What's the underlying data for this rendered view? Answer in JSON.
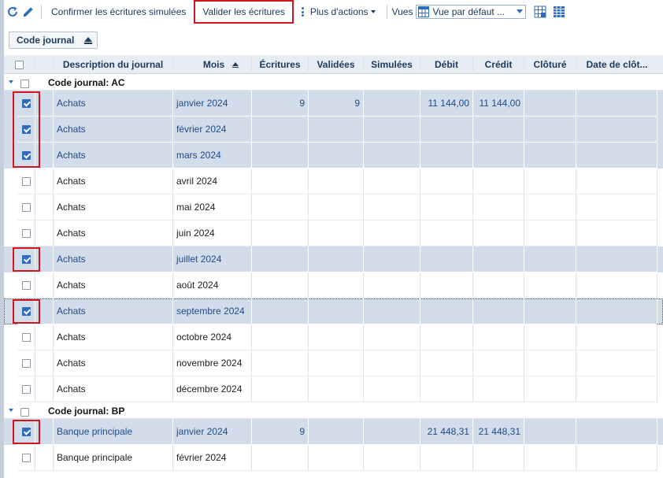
{
  "toolbar": {
    "refresh_icon": "refresh-icon",
    "edit_icon": "pencil-icon",
    "confirm_label": "Confirmer les écritures simulées",
    "validate_label": "Valider les écritures",
    "more_label": "Plus d'actions",
    "views_label": "Vues",
    "view_select_value": "Vue par défaut ..."
  },
  "grouping": {
    "label": "Code journal"
  },
  "columns": {
    "description": "Description du journal",
    "month": "Mois",
    "entries": "Écritures",
    "validated": "Validées",
    "simulated": "Simulées",
    "debit": "Débit",
    "credit": "Crédit",
    "closed": "Clôturé",
    "close_date": "Date de clôt..."
  },
  "groups": [
    {
      "title": "Code journal: AC",
      "rows": [
        {
          "desc": "Achats",
          "month": "janvier 2024",
          "entries": "9",
          "validated": "9",
          "simulated": "",
          "debit": "11 144,00",
          "credit": "11 144,00",
          "closed": "",
          "close_date": "",
          "checked": true
        },
        {
          "desc": "Achats",
          "month": "février 2024",
          "entries": "",
          "validated": "",
          "simulated": "",
          "debit": "",
          "credit": "",
          "closed": "",
          "close_date": "",
          "checked": true
        },
        {
          "desc": "Achats",
          "month": "mars 2024",
          "entries": "",
          "validated": "",
          "simulated": "",
          "debit": "",
          "credit": "",
          "closed": "",
          "close_date": "",
          "checked": true
        },
        {
          "desc": "Achats",
          "month": "avril 2024",
          "entries": "",
          "validated": "",
          "simulated": "",
          "debit": "",
          "credit": "",
          "closed": "",
          "close_date": "",
          "checked": false
        },
        {
          "desc": "Achats",
          "month": "mai 2024",
          "entries": "",
          "validated": "",
          "simulated": "",
          "debit": "",
          "credit": "",
          "closed": "",
          "close_date": "",
          "checked": false
        },
        {
          "desc": "Achats",
          "month": "juin 2024",
          "entries": "",
          "validated": "",
          "simulated": "",
          "debit": "",
          "credit": "",
          "closed": "",
          "close_date": "",
          "checked": false
        },
        {
          "desc": "Achats",
          "month": "juillet 2024",
          "entries": "",
          "validated": "",
          "simulated": "",
          "debit": "",
          "credit": "",
          "closed": "",
          "close_date": "",
          "checked": true
        },
        {
          "desc": "Achats",
          "month": "août 2024",
          "entries": "",
          "validated": "",
          "simulated": "",
          "debit": "",
          "credit": "",
          "closed": "",
          "close_date": "",
          "checked": false
        },
        {
          "desc": "Achats",
          "month": "septembre 2024",
          "entries": "",
          "validated": "",
          "simulated": "",
          "debit": "",
          "credit": "",
          "closed": "",
          "close_date": "",
          "checked": true,
          "focused": true
        },
        {
          "desc": "Achats",
          "month": "octobre 2024",
          "entries": "",
          "validated": "",
          "simulated": "",
          "debit": "",
          "credit": "",
          "closed": "",
          "close_date": "",
          "checked": false
        },
        {
          "desc": "Achats",
          "month": "novembre 2024",
          "entries": "",
          "validated": "",
          "simulated": "",
          "debit": "",
          "credit": "",
          "closed": "",
          "close_date": "",
          "checked": false
        },
        {
          "desc": "Achats",
          "month": "décembre 2024",
          "entries": "",
          "validated": "",
          "simulated": "",
          "debit": "",
          "credit": "",
          "closed": "",
          "close_date": "",
          "checked": false
        }
      ]
    },
    {
      "title": "Code journal: BP",
      "rows": [
        {
          "desc": "Banque principale",
          "month": "janvier 2024",
          "entries": "9",
          "validated": "",
          "simulated": "",
          "debit": "21 448,31",
          "credit": "21 448,31",
          "closed": "",
          "close_date": "",
          "checked": true
        },
        {
          "desc": "Banque principale",
          "month": "février 2024",
          "entries": "",
          "validated": "",
          "simulated": "",
          "debit": "",
          "credit": "",
          "closed": "",
          "close_date": "",
          "checked": false
        }
      ]
    }
  ],
  "colors": {
    "accent": "#2f6cc0",
    "selected_row": "#d3dcea",
    "highlight_border": "#d0161f",
    "header_bg": "#e8edf4",
    "text_link": "#1d3b60"
  }
}
